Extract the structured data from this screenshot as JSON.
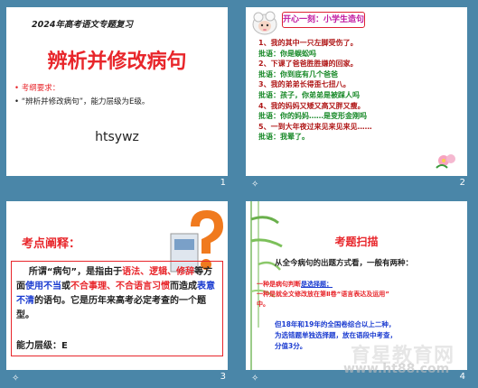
{
  "slides": [
    {
      "number": "1",
      "title": "2024年高考语文专题复习",
      "main": "辨析并修改病句",
      "bullet1": "• 考纲要求：",
      "bullet2": "• “辨析并修改病句”，能力层级为E级。",
      "footer": "htsywz"
    },
    {
      "number": "2",
      "header": "开心一刻：小学生造句",
      "lines": [
        {
          "t": "1、我的其中一只左脚受伤了。",
          "c": "#b01818"
        },
        {
          "t": "批语：你是蜈蚣吗",
          "c": "#1a8a2a"
        },
        {
          "t": "2、下课了爸爸胜胜嫌的回家。",
          "c": "#b01818"
        },
        {
          "t": "批语：你到底有几个爸爸",
          "c": "#1a8a2a"
        },
        {
          "t": "3、我的弟弟长得歪七扭八。",
          "c": "#b01818"
        },
        {
          "t": "批语：孩子，你弟弟是被踩人吗",
          "c": "#1a8a2a"
        },
        {
          "t": "4、我的妈妈又矮又高又胖又瘦。",
          "c": "#b01818"
        },
        {
          "t": "批语：你的妈妈……是变形金刚吗",
          "c": "#1a8a2a"
        },
        {
          "t": "5、一到大年夜过来见来见来见……",
          "c": "#b01818"
        },
        {
          "t": "批语：我晕了。",
          "c": "#1a8a2a"
        }
      ]
    },
    {
      "number": "3",
      "header": "考点阐释：",
      "level": "能力层级：E"
    },
    {
      "number": "4",
      "title": "考题扫描",
      "sub": "从全今病句的出题方式看，一般有两种：",
      "line1a": "一种是病句判断",
      "line1b": "是选择题；",
      "line2a": "一种是就全文修改",
      "line2b": "放在第Ⅱ卷“语言表达及运用”",
      "line2c": "中。",
      "blue1": "但18年和19年的全国卷综合以上二种，",
      "blue2": "为选错题单独选择题，放在语段中考查，",
      "blue3": "分值3分。"
    }
  ],
  "watermark": "育星教育网",
  "watermark_url": "www.ht88.com",
  "fx_icon": "animation-icon"
}
